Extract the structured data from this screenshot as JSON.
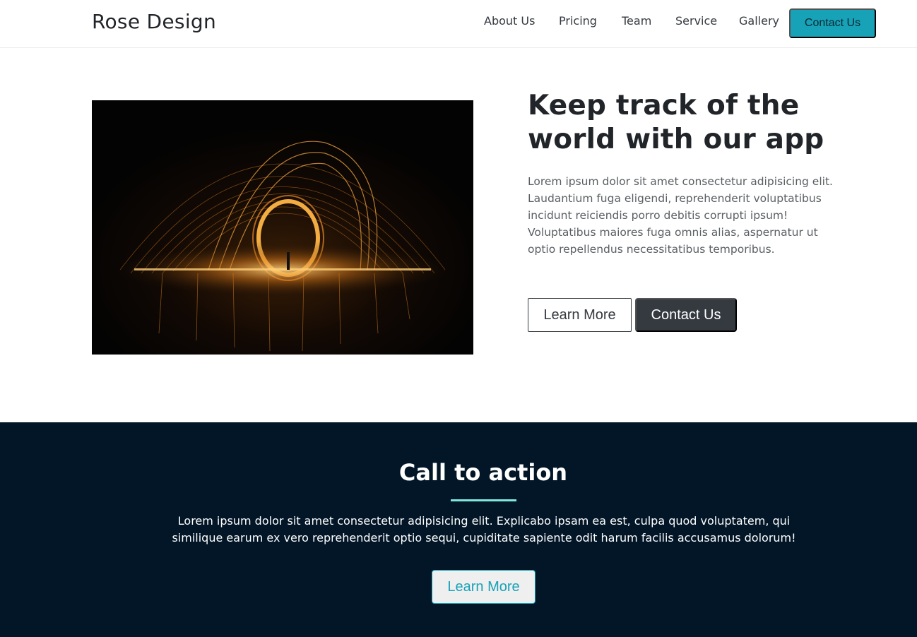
{
  "navbar": {
    "brand": "Rose Design",
    "links": [
      "About Us",
      "Pricing",
      "Team",
      "Service",
      "Gallery"
    ],
    "cta_label": "Contact Us"
  },
  "hero": {
    "image_alt": "steel-wool-light-painting-image",
    "title": "Keep track of the world with our app",
    "text": "Lorem ipsum dolor sit amet consectetur adipisicing elit. Laudantium fuga eligendi, reprehenderit voluptatibus incidunt reiciendis porro debitis corrupti ipsum! Voluptatibus maiores fuga omnis alias, aspernatur ut optio repellendus necessitatibus temporibus.",
    "learn_more_label": "Learn More",
    "contact_label": "Contact Us"
  },
  "cta": {
    "title": "Call to action",
    "text": "Lorem ipsum dolor sit amet consectetur adipisicing elit. Explicabo ipsam ea est, culpa quod voluptatem, qui similique earum ex vero reprehenderit optio sequi, cupiditate sapiente odit harum facilis accusamus dolorum!",
    "button_label": "Learn More"
  },
  "colors": {
    "accent": "#17a2b8",
    "dark": "#343a40",
    "cta_background": "#021627",
    "cta_underline": "#7fe6e0"
  }
}
